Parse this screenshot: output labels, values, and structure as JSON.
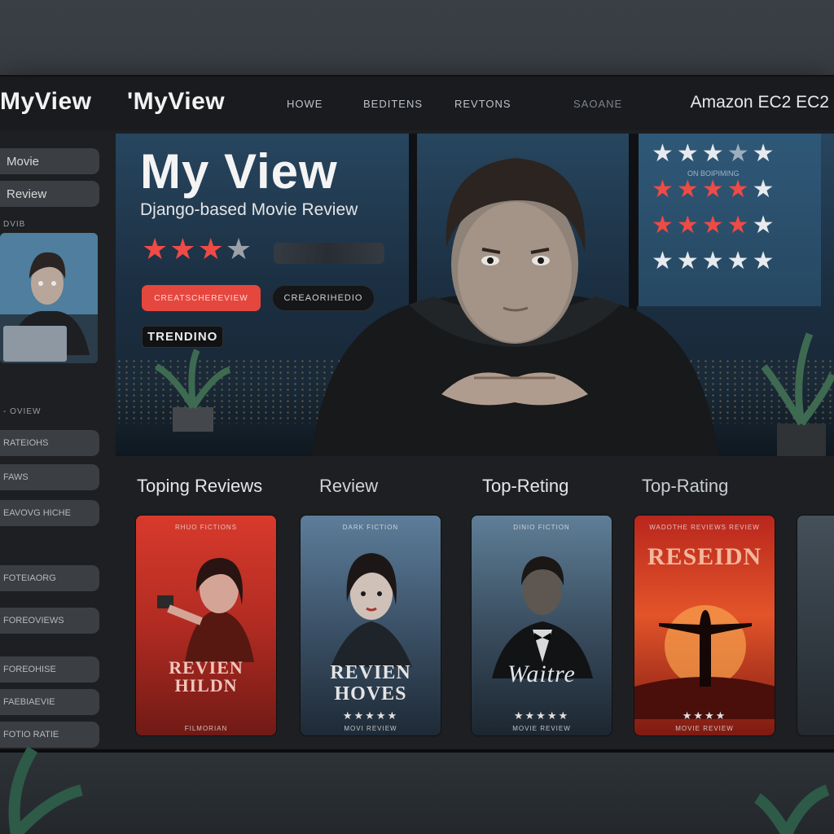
{
  "header": {
    "logo_primary": "MyView",
    "logo_secondary": "'MyView",
    "nav": [
      "HOWE",
      "BEDITENS",
      "REVTONS",
      "SAOANE"
    ],
    "provider": "Amazon EC2 EC2"
  },
  "sidebar": {
    "items": [
      "Movie",
      "Review"
    ],
    "section_label": "DVIB",
    "caption": "- OVIEW",
    "lower_items": [
      "RATEIOHS",
      "FAWS",
      "EAVOVG HICHE"
    ],
    "bottom_items": [
      "FOTEIAORG",
      "FOREOVIEWS",
      "FOREOHISE",
      "FAEBIAEVIE",
      "FOTIO RATIE"
    ]
  },
  "hero": {
    "title": "My View",
    "subtitle": "Django-based Movie Review",
    "rating": 3.5,
    "primary_button": "CREATSCHEREVIEW",
    "secondary_button": "CREAORIHEDIO",
    "badge": "TRENDINO"
  },
  "rating_panel": {
    "note": "ON BOIPIMING",
    "rows": [
      {
        "filled": 0,
        "total": 5
      },
      {
        "filled": 4,
        "total": 5
      },
      {
        "filled": 4,
        "total": 5
      },
      {
        "filled": 0,
        "total": 5
      }
    ]
  },
  "tabs": [
    "Toping Reviews",
    "Review",
    "Top-Reting",
    "Top-Rating"
  ],
  "posters": [
    {
      "top": "RHUO FICTIONS",
      "title": "REVIEN\nHILDN",
      "stars": "",
      "bottom": "FILMORIAN"
    },
    {
      "top": "DARK FICTION",
      "title": "REVIEN\nHOVES",
      "stars": "★★★★★",
      "bottom": "MOVI REVIEW"
    },
    {
      "top": "DINIO FICTION",
      "title": "Waitre",
      "stars": "★★★★★",
      "bottom": "MOVIE REVIEW"
    },
    {
      "top": "WADOTHE REVIEWS REVIEW",
      "title": "RESEIDN",
      "stars": "★★★★",
      "bottom": "MOVIE REVIEW"
    }
  ],
  "colors": {
    "accent_red": "#e5473f",
    "star_red": "#ee4b44",
    "panel": "#1d1f22"
  }
}
